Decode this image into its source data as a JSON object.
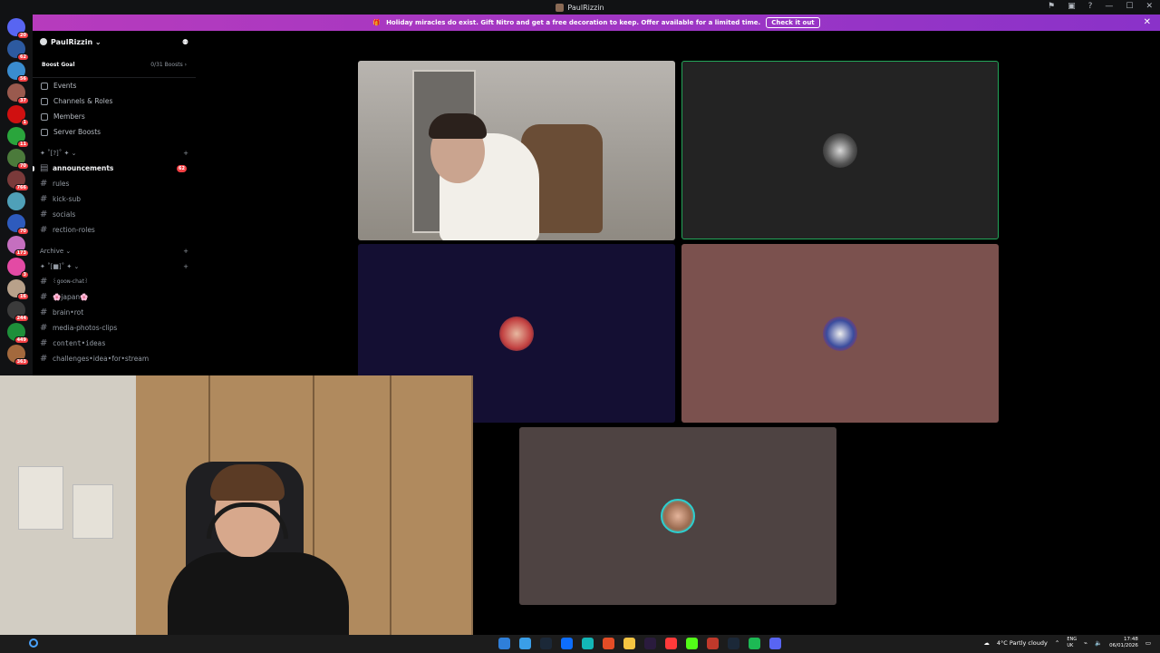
{
  "window": {
    "title": "PaulRizzin",
    "controls": [
      "⚑",
      "▣",
      "?",
      "—",
      "☐",
      "✕"
    ]
  },
  "rail_badges": [
    "20",
    "62",
    "56",
    "37",
    "1",
    "11",
    "70",
    "766",
    "",
    "70",
    "173",
    "3",
    "16",
    "244",
    "449",
    "363"
  ],
  "banner": {
    "text": "Holiday miracles do exist. Gift Nitro and get a free decoration to keep. Offer available for a limited time.",
    "cta": "Check it out",
    "close": "✕"
  },
  "guild": {
    "name": "PaulRizzin ⌄",
    "boost_label": "Boost Goal",
    "boost_count": "0/31 Boosts ›"
  },
  "menu": [
    "Events",
    "Channels & Roles",
    "Members",
    "Server Boosts"
  ],
  "categories": {
    "cat1": "✦ ˚[?]˚ ✦ ⌄",
    "archive": "Archive ⌄",
    "cat2": "✦ ˚[■]˚ ✦ ⌄",
    "add": "+"
  },
  "channels_a": [
    {
      "name": "announcements",
      "badge": "62"
    },
    {
      "name": "rules"
    },
    {
      "name": "kick-sub"
    },
    {
      "name": "socials"
    },
    {
      "name": "rection-roles"
    }
  ],
  "channels_b": [
    {
      "name": "꒰gooɴ-chat꒱"
    },
    {
      "name": "🌸japan🌸"
    },
    {
      "name": "brain•rot"
    },
    {
      "name": "media-photos-clips"
    },
    {
      "name": "content•ideas"
    },
    {
      "name": "challenges•idea•for•stream"
    }
  ],
  "tray": {
    "weather": "4°C  Partly cloudy",
    "lang_top": "ENG",
    "lang_bottom": "UK",
    "time": "17:48",
    "date": "06/01/2026"
  },
  "colors": {
    "speaking": "#23a559",
    "tile_blue": "#140f33",
    "tile_rose": "#7b514e",
    "tile_brown": "#4e4342",
    "tile_dark": "#232323"
  }
}
